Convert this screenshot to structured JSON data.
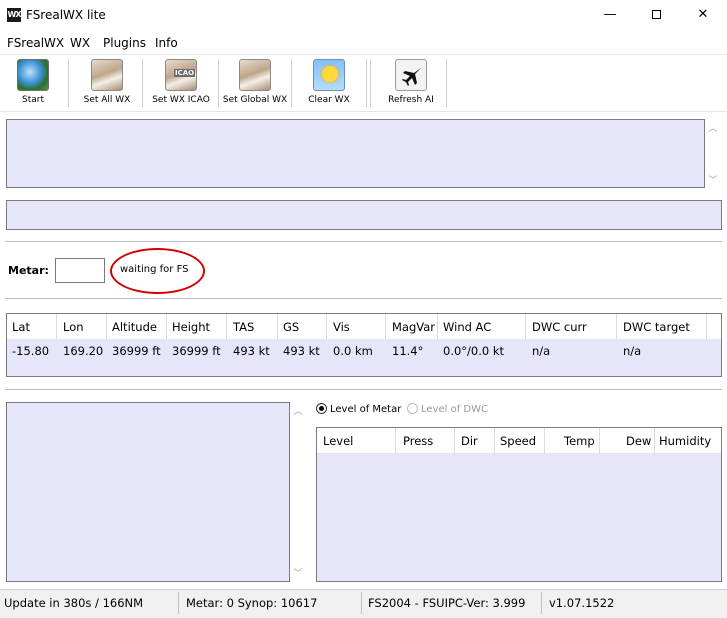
{
  "window": {
    "title": "FSrealWX lite",
    "icon_text": "WX",
    "minimize": "—",
    "close": "✕"
  },
  "menu": {
    "items": [
      "FSrealWX",
      "WX",
      "Plugins",
      "Info"
    ]
  },
  "toolbar": {
    "start": "Start",
    "set_all_wx": "Set All WX",
    "set_wx_icao": "Set WX ICAO",
    "set_global_wx": "Set Global WX",
    "clear_wx": "Clear WX",
    "refresh_ai": "Refresh AI",
    "icao_badge": "ICAO"
  },
  "metar_panel": {
    "label": "Metar:",
    "input_value": "",
    "status": "waiting for FS"
  },
  "data_table": {
    "headers": [
      "Lat",
      "Lon",
      "Altitude",
      "Height",
      "TAS",
      "GS",
      "Vis",
      "MagVar",
      "Wind AC",
      "DWC curr",
      "DWC target"
    ],
    "row": [
      "-15.80",
      "169.20",
      "36999 ft",
      "36999 ft",
      "493 kt",
      "493 kt",
      "0.0 km",
      "11.4°",
      "0.0°/0.0 kt",
      "n/a",
      "n/a"
    ]
  },
  "level_panel": {
    "radio_metar": "Level of Metar",
    "radio_dwc": "Level of DWC",
    "headers": [
      "Level",
      "Press",
      "Dir",
      "Speed",
      "Temp",
      "Dew",
      "Humidity"
    ]
  },
  "statusbar": {
    "update": "Update in 380s / 166NM",
    "counts": "Metar: 0 Synop: 10617",
    "fsuipc": "FS2004 - FSUIPC-Ver: 3.999",
    "version": "v1.07.1522"
  },
  "colors": {
    "panel_bg": "#e6e6fa",
    "highlight_circle": "#d40000"
  }
}
